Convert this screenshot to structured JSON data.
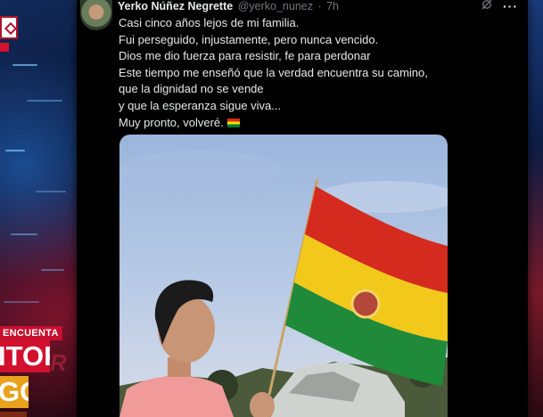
{
  "broadcast": {
    "kicker": "ENCUENTA",
    "headline_line1": "ITOR",
    "headline_line2": "GO",
    "ghost_text": "R"
  },
  "tweet": {
    "display_name": "Yerko Núñez Negrette",
    "handle": "@yerko_nunez",
    "separator": "·",
    "time": "7h",
    "lines": [
      "Casi cinco años lejos de mi familia.",
      "Fui perseguido, injustamente, pero nunca vencido.",
      "Dios me dio fuerza para resistir, fe para perdonar",
      "Este tiempo me enseñó que la verdad encuentra su camino,",
      "que la dignidad no se vende",
      "y que la esperanza sigue viva...",
      "Muy pronto, volveré."
    ],
    "emoji": "bolivia-flag",
    "more_icon": "···",
    "grok_icon": "grok-icon"
  },
  "colors": {
    "tweet_bg": "#000000",
    "text": "#e7e9ea",
    "muted": "#71767b",
    "bolivia_red": "#d52b1e",
    "bolivia_yellow": "#f9e300",
    "bolivia_green": "#007934",
    "broadcast_red": "#c8102e",
    "broadcast_orange": "#e8a21b"
  }
}
